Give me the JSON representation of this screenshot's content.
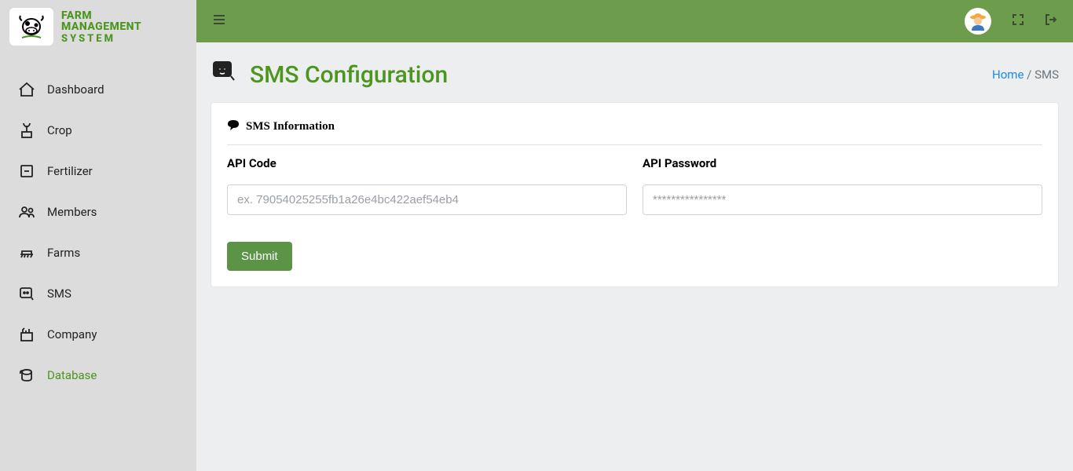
{
  "brand": {
    "line1": "FARM",
    "line2": "MANAGEMENT",
    "line3": "SYSTEM"
  },
  "sidebar": {
    "items": [
      {
        "label": "Dashboard"
      },
      {
        "label": "Crop"
      },
      {
        "label": "Fertilizer"
      },
      {
        "label": "Members"
      },
      {
        "label": "Farms"
      },
      {
        "label": "SMS"
      },
      {
        "label": "Company"
      },
      {
        "label": "Database"
      }
    ]
  },
  "page": {
    "title": "SMS Configuration",
    "breadcrumb": {
      "home": "Home",
      "current": "SMS"
    }
  },
  "form": {
    "section_title": "SMS Information",
    "api_code_label": "API Code",
    "api_code_placeholder": "ex. 79054025255fb1a26e4bc422aef54eb4",
    "api_password_label": "API Password",
    "api_password_placeholder": "****************",
    "submit_label": "Submit"
  }
}
